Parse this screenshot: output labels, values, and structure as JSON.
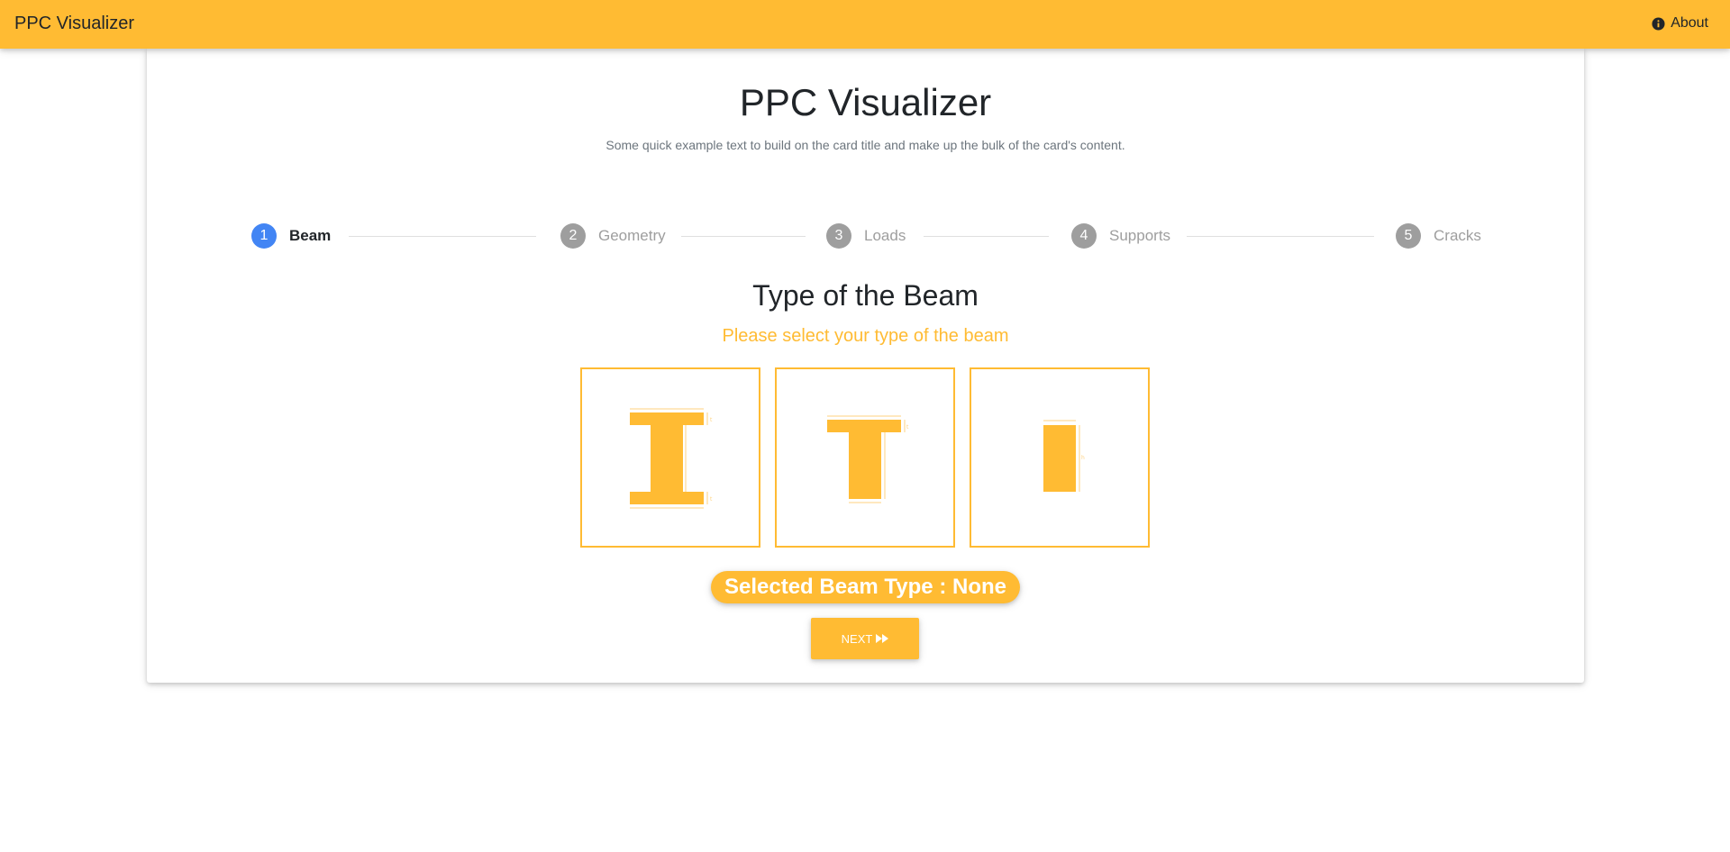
{
  "colors": {
    "navbar": "#ffbb33",
    "accent": "#ffbb33",
    "step_active": "#4285f4",
    "step_inactive": "#9e9e9e"
  },
  "navbar": {
    "brand": "PPC Visualizer",
    "about_label": "About",
    "about_icon": "info-circle-icon"
  },
  "card": {
    "title": "PPC Visualizer",
    "text": "Some quick example text to build on the card title and make up the bulk of the card's content."
  },
  "stepper": {
    "steps": [
      {
        "number": "1",
        "label": "Beam",
        "active": true
      },
      {
        "number": "2",
        "label": "Geometry",
        "active": false
      },
      {
        "number": "3",
        "label": "Loads",
        "active": false
      },
      {
        "number": "4",
        "label": "Supports",
        "active": false
      },
      {
        "number": "5",
        "label": "Cracks",
        "active": false
      }
    ]
  },
  "beam_section": {
    "title": "Type of the Beam",
    "subtitle": "Please select your type of the beam",
    "options": [
      {
        "name": "i-beam",
        "icon": "i-beam-icon"
      },
      {
        "name": "t-beam",
        "icon": "t-beam-icon"
      },
      {
        "name": "rectangular-beam",
        "icon": "rectangular-beam-icon"
      }
    ],
    "selected_text": "Selected Beam Type : None"
  },
  "actions": {
    "next_label": "NEXT",
    "next_icon": "fast-forward-icon"
  }
}
